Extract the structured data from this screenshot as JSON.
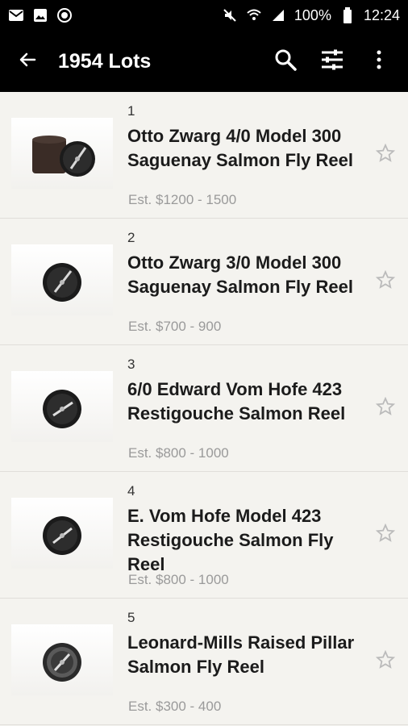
{
  "status_bar": {
    "battery": "100%",
    "time": "12:24",
    "icons": [
      "mail-icon",
      "image-icon",
      "sync-icon",
      "mute-icon",
      "wifi-icon",
      "signal-icon",
      "battery-icon"
    ]
  },
  "app_bar": {
    "title": "1954 Lots",
    "icons": [
      "back-arrow-icon",
      "search-icon",
      "filter-icon",
      "more-vert-icon"
    ]
  },
  "lots": [
    {
      "number": "1",
      "name": "Otto Zwarg 4/0 Model 300 Saguenay Salmon Fly Reel",
      "estimate": "Est. $1200 - 1500"
    },
    {
      "number": "2",
      "name": "Otto Zwarg 3/0 Model 300 Saguenay Salmon Fly Reel",
      "estimate": "Est. $700 - 900"
    },
    {
      "number": "3",
      "name": "6/0 Edward Vom Hofe 423 Restigouche Salmon Reel",
      "estimate": "Est. $800 - 1000"
    },
    {
      "number": "4",
      "name": "E. Vom Hofe Model 423 Restigouche Salmon Fly Reel",
      "estimate": "Est. $800 - 1000"
    },
    {
      "number": "5",
      "name": "Leonard-Mills Raised Pillar Salmon Fly Reel",
      "estimate": "Est. $300 - 400"
    }
  ],
  "colors": {
    "bar": "#000000",
    "background": "#f4f3ef",
    "estimate": "#9a9a9a"
  }
}
